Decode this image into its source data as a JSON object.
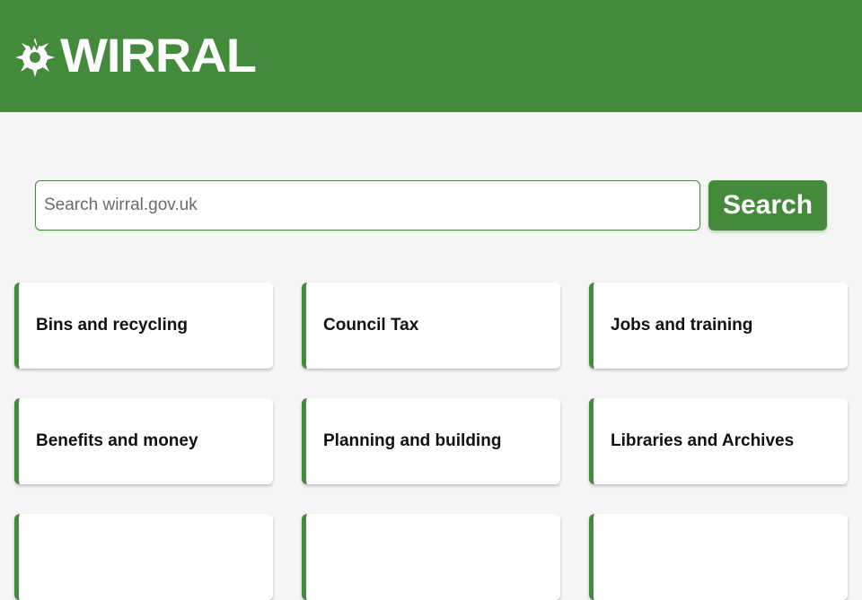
{
  "header": {
    "logo_text": "WIRRAL",
    "background_color": "#438a3a"
  },
  "search": {
    "placeholder": "Search wirral.gov.uk",
    "value": "",
    "button_label": "Search"
  },
  "tiles": [
    {
      "label": "Bins and recycling"
    },
    {
      "label": "Council Tax"
    },
    {
      "label": "Jobs and training"
    },
    {
      "label": "Benefits and money"
    },
    {
      "label": "Planning and building"
    },
    {
      "label": "Libraries and Archives"
    },
    {
      "label": ""
    },
    {
      "label": ""
    },
    {
      "label": ""
    }
  ],
  "colors": {
    "accent": "#438a3a",
    "page_background": "#f6f6f6",
    "tile_background": "#ffffff"
  }
}
